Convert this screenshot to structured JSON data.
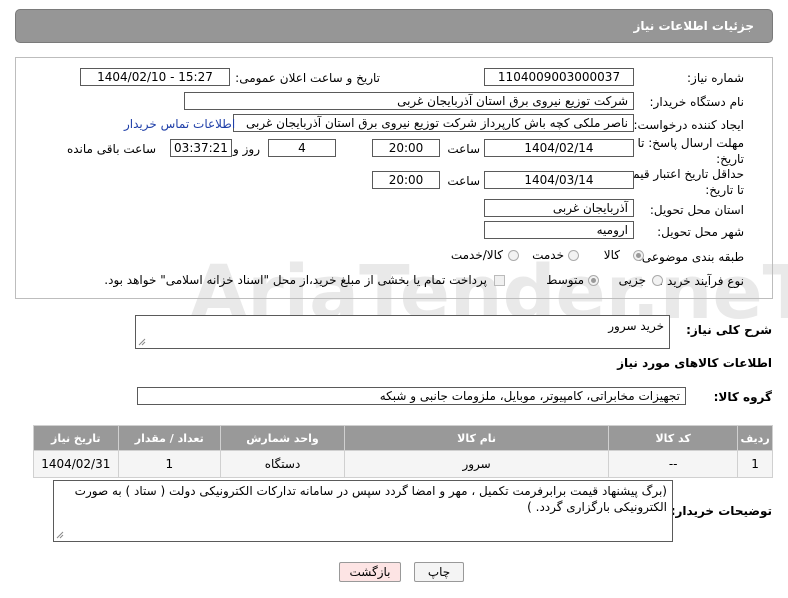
{
  "header": {
    "title": "جزئیات اطلاعات نیاز"
  },
  "watermark": {
    "text": "AriaTender.neT"
  },
  "form": {
    "need_number": {
      "label": "شماره نیاز:",
      "value": "1104009003000037"
    },
    "announce": {
      "label": "تاریخ و ساعت اعلان عمومی:",
      "value": "1404/02/10 - 15:27"
    },
    "buyer_org": {
      "label": "نام دستگاه خریدار:",
      "value": "شرکت توزیع نیروی برق استان آذربایجان غربی"
    },
    "creator": {
      "label": "ایجاد کننده درخواست:",
      "value": "ناصر ملکی کچه باش کارپرداز شرکت توزیع نیروی برق استان آذربایجان غربی",
      "contact_link": "اطلاعات تماس خریدار"
    },
    "deadline": {
      "label_line1": "مهلت ارسال پاسخ: تا",
      "label_line2": "تاریخ:",
      "date": "1404/02/14",
      "time_label": "ساعت",
      "time": "20:00",
      "days": "4",
      "days_label": "روز و",
      "remaining": "03:37:21",
      "remaining_label": "ساعت باقی مانده"
    },
    "validity": {
      "label_line1": "حداقل تاریخ اعتبار قیمت:",
      "label_line2": "تا تاریخ:",
      "date": "1404/03/14",
      "time_label": "ساعت",
      "time": "20:00"
    },
    "province": {
      "label": "استان محل تحویل:",
      "value": "آذربایجان غربی"
    },
    "city": {
      "label": "شهر محل تحویل:",
      "value": "ارومیه"
    },
    "category": {
      "label": "طبقه بندی موضوعی:",
      "options": [
        "کالا",
        "خدمت",
        "کالا/خدمت"
      ],
      "selected": "کالا"
    },
    "process": {
      "label": "نوع فرآیند خرید :",
      "options": [
        "جزیی",
        "متوسط"
      ],
      "selected": "متوسط",
      "note": "پرداخت تمام یا بخشی از مبلغ خرید،از محل \"اسناد خزانه اسلامی\" خواهد بود."
    }
  },
  "description": {
    "label": "شرح کلی نیاز:",
    "value": "خرید سرور"
  },
  "goods_info": {
    "title": "اطلاعات کالاهای مورد نیاز"
  },
  "goods_group": {
    "label": "گروه کالا:",
    "value": "تجهیزات مخابراتی، کامپیوتر، موبایل، ملزومات جانبی و شبکه"
  },
  "table": {
    "headers": [
      "ردیف",
      "کد کالا",
      "نام کالا",
      "واحد شمارش",
      "تعداد / مقدار",
      "تاریخ نیاز"
    ],
    "rows": [
      [
        "1",
        "--",
        "سرور",
        "دستگاه",
        "1",
        "1404/02/31"
      ]
    ]
  },
  "buyer_notes": {
    "label": "توضیحات خریدار:",
    "value": "(برگ پیشنهاد قیمت برابرفرمت تکمیل ، مهر و امضا گردد سپس در سامانه تدارکات الکترونیکی دولت ( ستاد ) به صورت الکترونیکی  بارگزاری گردد. )"
  },
  "buttons": {
    "print": "چاپ",
    "back": "بازگشت"
  },
  "colors": {
    "header_bg": "#969696",
    "link": "#1f3fa8",
    "back_button_bg": "#fde4e4"
  }
}
